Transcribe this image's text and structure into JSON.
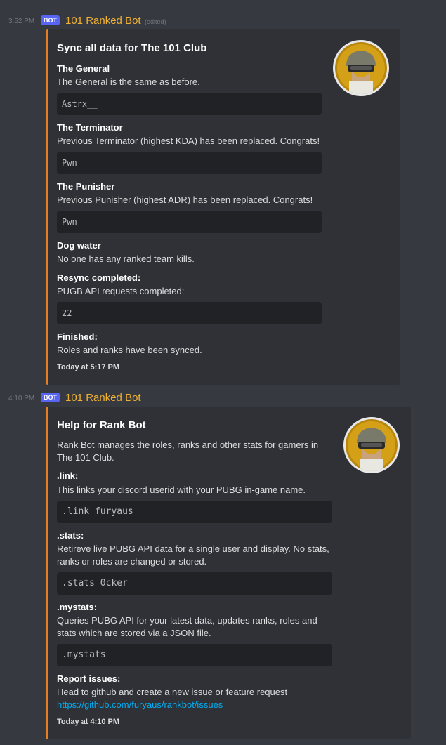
{
  "message1": {
    "timestamp": "3:52 PM",
    "bot_tag": "BOT",
    "username": "101 Ranked Bot",
    "edited": "(edited)",
    "embed": {
      "title": "Sync all data for The 101 Club",
      "fields": [
        {
          "name": "The General",
          "value": "The General is the same as before.",
          "code": "Astrx__"
        },
        {
          "name": "The Terminator",
          "value": "Previous Terminator (highest KDA) has been replaced. Congrats!",
          "code": "Pwn"
        },
        {
          "name": "The Punisher",
          "value": "Previous Punisher (highest ADR) has been replaced. Congrats!",
          "code": "Pwn"
        },
        {
          "name": "Dog water",
          "value": "No one has any ranked team kills."
        },
        {
          "name": "Resync completed:",
          "value": "PUGB API requests completed:",
          "code": "22"
        },
        {
          "name": "Finished:",
          "value": "Roles and ranks have been synced."
        }
      ],
      "footer": "Today at 5:17 PM"
    }
  },
  "message2": {
    "timestamp": "4:10 PM",
    "bot_tag": "BOT",
    "username": "101 Ranked Bot",
    "embed": {
      "title": "Help for Rank Bot",
      "description_line1": "Rank Bot manages the roles, ranks and other stats for gamers in",
      "description_line2": "The 101 Club.",
      "fields": [
        {
          "name": ".link:",
          "value1": "This links your discord userid with your PUBG in-game name.",
          "code": ".link furyaus"
        },
        {
          "name": ".stats:",
          "value1": "Retireve live PUBG API data for a single user and display. No stats,",
          "value2": "ranks or roles are changed or stored.",
          "code": ".stats 0cker"
        },
        {
          "name": ".mystats:",
          "value1": "Queries PUBG API for your latest data, updates ranks, roles and",
          "value2": "stats which are stored via a JSON file.",
          "code": ".mystats"
        },
        {
          "name": "Report issues:",
          "value1": "Head to github and create a new issue or feature request",
          "link": "https://github.com/furyaus/rankbot/issues"
        }
      ],
      "footer": "Today at 4:10 PM"
    }
  },
  "colors": {
    "background": "#36393f",
    "embed_bg": "#2f3136",
    "embed_accent": "#e67e22",
    "username": "#f0b132",
    "link": "#00aff4",
    "bot_tag": "#5865f2"
  },
  "icons": {
    "thumbnail": "pubg-helmet-avatar-icon"
  }
}
